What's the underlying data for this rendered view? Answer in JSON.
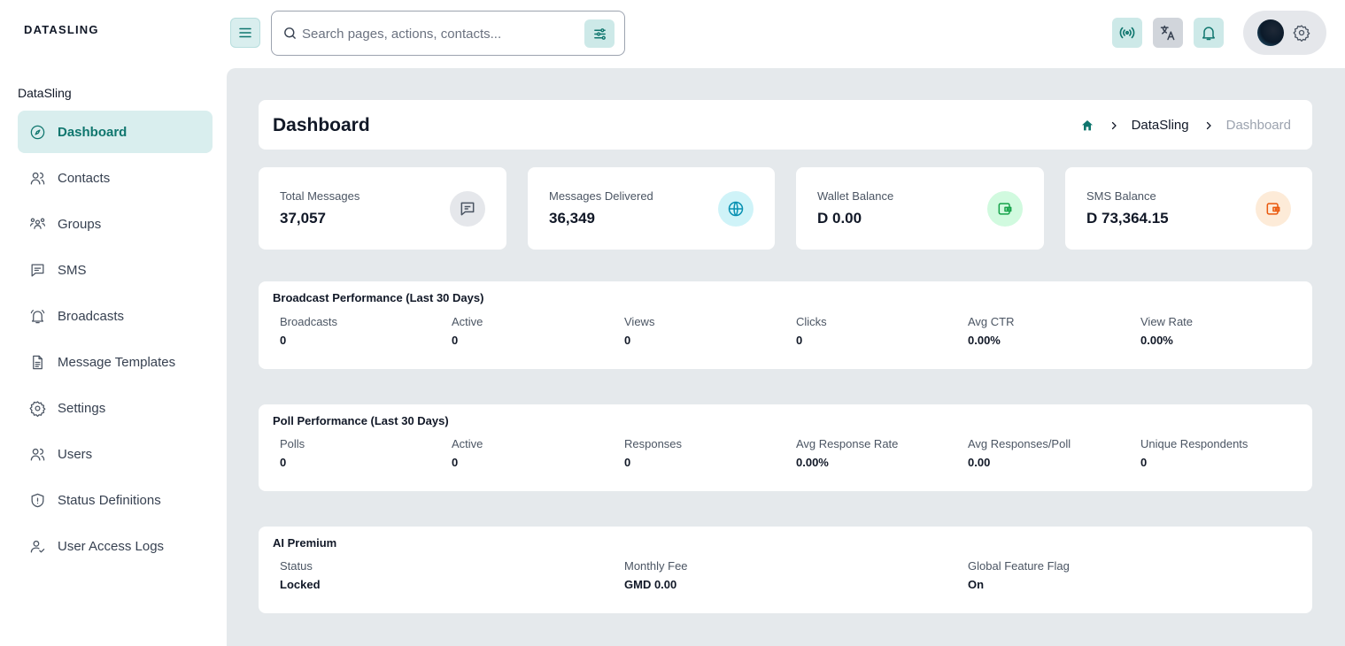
{
  "app": {
    "logo": "DATASLING"
  },
  "sidebar": {
    "section_title": "DataSling",
    "items": [
      {
        "label": "Dashboard",
        "icon": "dashboard-icon",
        "active": true
      },
      {
        "label": "Contacts",
        "icon": "users-icon"
      },
      {
        "label": "Groups",
        "icon": "groups-icon"
      },
      {
        "label": "SMS",
        "icon": "message-icon"
      },
      {
        "label": "Broadcasts",
        "icon": "bell-ring-icon"
      },
      {
        "label": "Message Templates",
        "icon": "document-icon"
      },
      {
        "label": "Settings",
        "icon": "gear-icon"
      },
      {
        "label": "Users",
        "icon": "users-icon"
      },
      {
        "label": "Status Definitions",
        "icon": "shield-icon"
      },
      {
        "label": "User Access Logs",
        "icon": "user-check-icon"
      }
    ]
  },
  "topbar": {
    "search_placeholder": "Search pages, actions, contacts...",
    "buttons": [
      "menu-icon",
      "filter-icon",
      "broadcast-signal-icon",
      "translate-icon",
      "bell-icon",
      "gear-icon"
    ]
  },
  "header": {
    "title": "Dashboard",
    "breadcrumb": [
      "DataSling",
      "Dashboard"
    ]
  },
  "stats": [
    {
      "label": "Total Messages",
      "value": "37,057",
      "icon": "chat-icon",
      "color": "#6b7280"
    },
    {
      "label": "Messages Delivered",
      "value": "36,349",
      "icon": "globe-icon",
      "color": "#0891b2"
    },
    {
      "label": "Wallet Balance",
      "value": "D 0.00",
      "icon": "wallet-icon",
      "color": "#16a34a"
    },
    {
      "label": "SMS Balance",
      "value": "D 73,364.15",
      "icon": "wallet-icon",
      "color": "#ea580c"
    }
  ],
  "broadcast_performance": {
    "title": "Broadcast Performance (Last 30 Days)",
    "metrics": [
      {
        "label": "Broadcasts",
        "value": "0"
      },
      {
        "label": "Active",
        "value": "0"
      },
      {
        "label": "Views",
        "value": "0"
      },
      {
        "label": "Clicks",
        "value": "0"
      },
      {
        "label": "Avg CTR",
        "value": "0.00%"
      },
      {
        "label": "View Rate",
        "value": "0.00%"
      }
    ]
  },
  "poll_performance": {
    "title": "Poll Performance (Last 30 Days)",
    "metrics": [
      {
        "label": "Polls",
        "value": "0"
      },
      {
        "label": "Active",
        "value": "0"
      },
      {
        "label": "Responses",
        "value": "0"
      },
      {
        "label": "Avg Response Rate",
        "value": "0.00%"
      },
      {
        "label": "Avg Responses/Poll",
        "value": "0.00"
      },
      {
        "label": "Unique Respondents",
        "value": "0"
      }
    ]
  },
  "ai_premium": {
    "title": "AI Premium",
    "metrics": [
      {
        "label": "Status",
        "value": "Locked"
      },
      {
        "label": "Monthly Fee",
        "value": "GMD 0.00"
      },
      {
        "label": "Global Feature Flag",
        "value": "On"
      }
    ]
  },
  "colors": {
    "accent": "#0f766e",
    "accent_bg": "#d9eeee",
    "main_bg": "#e5e9ec"
  }
}
